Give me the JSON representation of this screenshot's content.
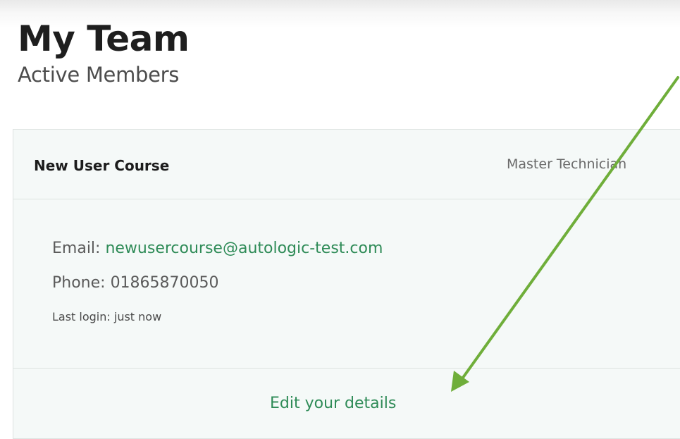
{
  "page": {
    "title": "My Team",
    "subtitle": "Active Members"
  },
  "member": {
    "name": "New User Course",
    "role": "Master Technician",
    "email_label": "Email: ",
    "email": "newusercourse@autologic-test.com",
    "phone_label": "Phone: ",
    "phone": "01865870050",
    "last_login_label": "Last login: ",
    "last_login": "just now",
    "edit_link": "Edit your details"
  },
  "colors": {
    "accent": "#2e8b57",
    "annotation_arrow": "#6fae3a"
  }
}
